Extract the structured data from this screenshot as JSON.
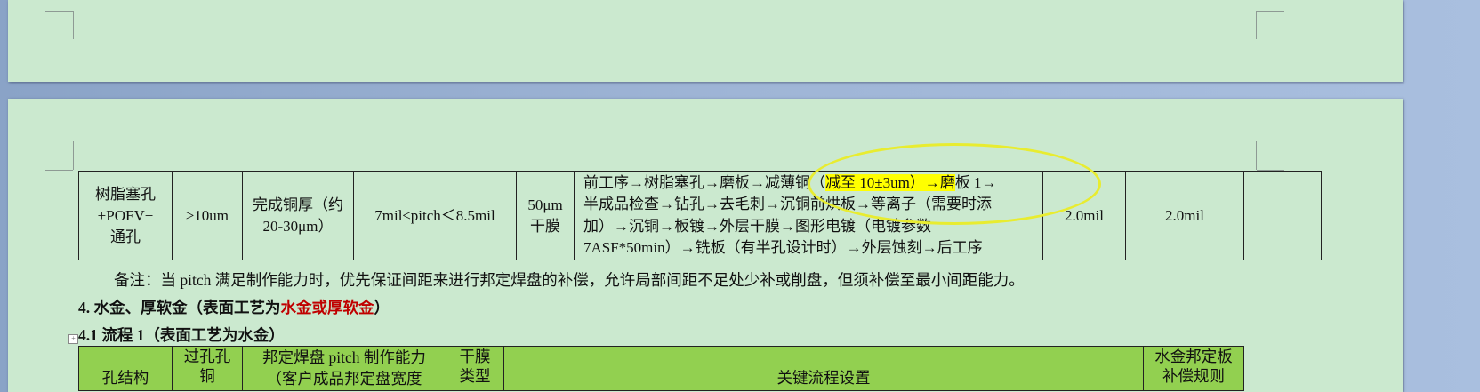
{
  "table1": {
    "row": {
      "structure": "树脂塞孔\n+POFV+\n通孔",
      "copper_plating": "≥10um",
      "finished_copper": "完成铜厚（约\n20-30μm）",
      "pitch": "7mil≤pitch＜8.5mil",
      "dry_film": "50μm\n干膜",
      "flow_before": "前工序→树脂塞孔→磨板→减薄铜（",
      "flow_highlight": "减至 10±3um）→磨",
      "flow_after": "板 1→\n半成品检查→钻孔→去毛刺→沉铜前烘板→等离子（需要时添\n加）→沉铜→板镀→外层干膜→图形电镀（电镀参数\n7ASF*50min）→铣板（有半孔设计时）→外层蚀刻→后工序",
      "compensation_1": "2.0mil",
      "compensation_2": "2.0mil",
      "extra": ""
    }
  },
  "note": "备注：当 pitch 满足制作能力时，优先保证间距来进行邦定焊盘的补偿，允许局部间距不足处少补或削盘，但须补偿至最小间距能力。",
  "section4": {
    "prefix": "4. 水金、厚软金（表面工艺为",
    "red": "水金或厚软金",
    "suffix": "）"
  },
  "section41": "4.1   流程 1（表面工艺为水金）",
  "table2": {
    "headers": [
      "孔结构",
      "过孔孔\n铜",
      "邦定焊盘 pitch 制作能力\n（客户成品邦定盘宽度",
      "干膜\n类型",
      "关键流程设置",
      "水金邦定板\n补偿规则"
    ]
  },
  "colors": {
    "page": "#cbe9cf",
    "highlight": "#ffff00",
    "header_fill": "#92d050",
    "red_text": "#c00000",
    "annotation_ellipse": "#e8ec30"
  }
}
